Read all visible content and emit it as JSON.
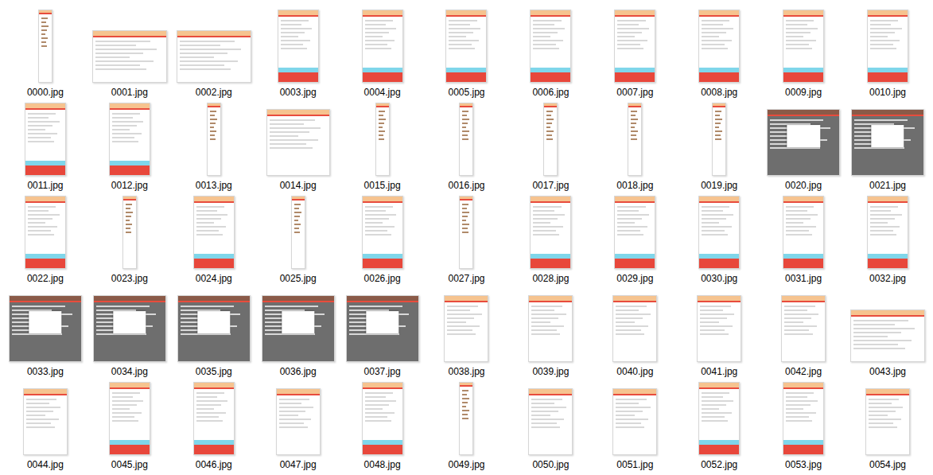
{
  "items": [
    {
      "label": "0000.jpg",
      "kind": "tall"
    },
    {
      "label": "0001.jpg",
      "kind": "wide"
    },
    {
      "label": "0002.jpg",
      "kind": "wide"
    },
    {
      "label": "0003.jpg",
      "kind": "page"
    },
    {
      "label": "0004.jpg",
      "kind": "page"
    },
    {
      "label": "0005.jpg",
      "kind": "page"
    },
    {
      "label": "0006.jpg",
      "kind": "page"
    },
    {
      "label": "0007.jpg",
      "kind": "page"
    },
    {
      "label": "0008.jpg",
      "kind": "page"
    },
    {
      "label": "0009.jpg",
      "kind": "page"
    },
    {
      "label": "0010.jpg",
      "kind": "page"
    },
    {
      "label": "0011.jpg",
      "kind": "page"
    },
    {
      "label": "0012.jpg",
      "kind": "page"
    },
    {
      "label": "0013.jpg",
      "kind": "tall"
    },
    {
      "label": "0014.jpg",
      "kind": "square"
    },
    {
      "label": "0015.jpg",
      "kind": "tall"
    },
    {
      "label": "0016.jpg",
      "kind": "tall"
    },
    {
      "label": "0017.jpg",
      "kind": "tall"
    },
    {
      "label": "0018.jpg",
      "kind": "tall"
    },
    {
      "label": "0019.jpg",
      "kind": "tall"
    },
    {
      "label": "0020.jpg",
      "kind": "dark"
    },
    {
      "label": "0021.jpg",
      "kind": "dark"
    },
    {
      "label": "0022.jpg",
      "kind": "page"
    },
    {
      "label": "0023.jpg",
      "kind": "tall"
    },
    {
      "label": "0024.jpg",
      "kind": "page"
    },
    {
      "label": "0025.jpg",
      "kind": "tall"
    },
    {
      "label": "0026.jpg",
      "kind": "page"
    },
    {
      "label": "0027.jpg",
      "kind": "tall"
    },
    {
      "label": "0028.jpg",
      "kind": "page"
    },
    {
      "label": "0029.jpg",
      "kind": "page"
    },
    {
      "label": "0030.jpg",
      "kind": "page"
    },
    {
      "label": "0031.jpg",
      "kind": "page"
    },
    {
      "label": "0032.jpg",
      "kind": "page"
    },
    {
      "label": "0033.jpg",
      "kind": "dark"
    },
    {
      "label": "0034.jpg",
      "kind": "dark"
    },
    {
      "label": "0035.jpg",
      "kind": "dark"
    },
    {
      "label": "0036.jpg",
      "kind": "dark"
    },
    {
      "label": "0037.jpg",
      "kind": "dark"
    },
    {
      "label": "0038.jpg",
      "kind": "plain"
    },
    {
      "label": "0039.jpg",
      "kind": "plain"
    },
    {
      "label": "0040.jpg",
      "kind": "plain"
    },
    {
      "label": "0041.jpg",
      "kind": "plain"
    },
    {
      "label": "0042.jpg",
      "kind": "plain"
    },
    {
      "label": "0043.jpg",
      "kind": "wide"
    },
    {
      "label": "0044.jpg",
      "kind": "plain"
    },
    {
      "label": "0045.jpg",
      "kind": "page"
    },
    {
      "label": "0046.jpg",
      "kind": "page"
    },
    {
      "label": "0047.jpg",
      "kind": "plain"
    },
    {
      "label": "0048.jpg",
      "kind": "page"
    },
    {
      "label": "0049.jpg",
      "kind": "tall"
    },
    {
      "label": "0050.jpg",
      "kind": "plain"
    },
    {
      "label": "0051.jpg",
      "kind": "plain"
    },
    {
      "label": "0052.jpg",
      "kind": "page"
    },
    {
      "label": "0053.jpg",
      "kind": "page"
    },
    {
      "label": "0054.jpg",
      "kind": "plain"
    }
  ]
}
